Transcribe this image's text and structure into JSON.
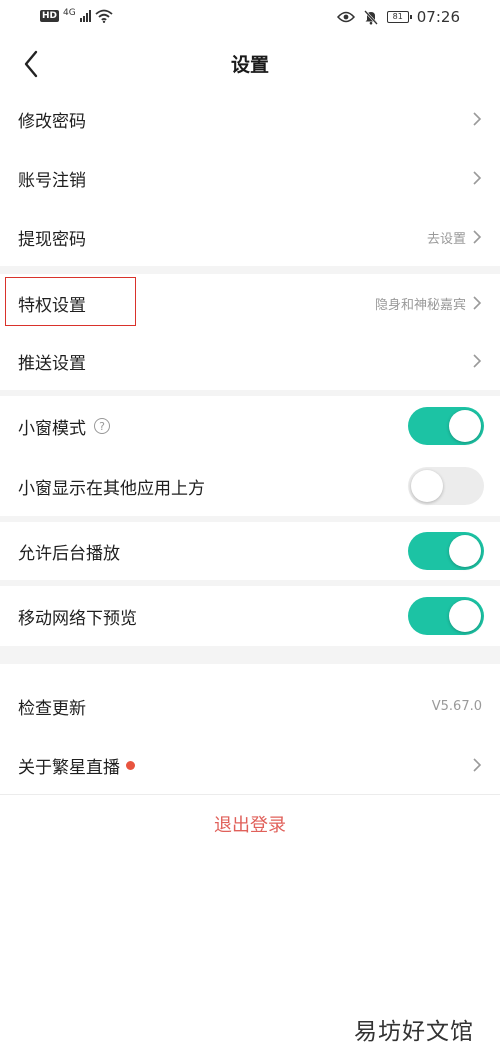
{
  "status_bar": {
    "hd": "HD",
    "network": "4G",
    "battery": "81",
    "time": "07:26"
  },
  "header": {
    "title": "设置"
  },
  "settings": {
    "change_password": {
      "label": "修改密码"
    },
    "account_cancel": {
      "label": "账号注销"
    },
    "withdraw_password": {
      "label": "提现密码",
      "value": "去设置"
    },
    "privilege_settings": {
      "label": "特权设置",
      "value": "隐身和神秘嘉宾"
    },
    "push_settings": {
      "label": "推送设置"
    },
    "small_window_mode": {
      "label": "小窗模式",
      "help": "?",
      "enabled": true
    },
    "small_window_on_top": {
      "label": "小窗显示在其他应用上方",
      "enabled": false
    },
    "background_play": {
      "label": "允许后台播放",
      "enabled": true
    },
    "mobile_preview": {
      "label": "移动网络下预览",
      "enabled": true
    },
    "check_update": {
      "label": "检查更新",
      "value": "V5.67.0"
    },
    "about": {
      "label": "关于繁星直播"
    }
  },
  "logout": {
    "label": "退出登录"
  },
  "watermark": {
    "text": "易坊好文馆"
  },
  "colors": {
    "toggle_on": "#1cc3a4",
    "toggle_off": "#ececec",
    "logout_text": "#e0605a",
    "badge_dot": "#e8543f",
    "highlight_border": "#d9322b"
  }
}
